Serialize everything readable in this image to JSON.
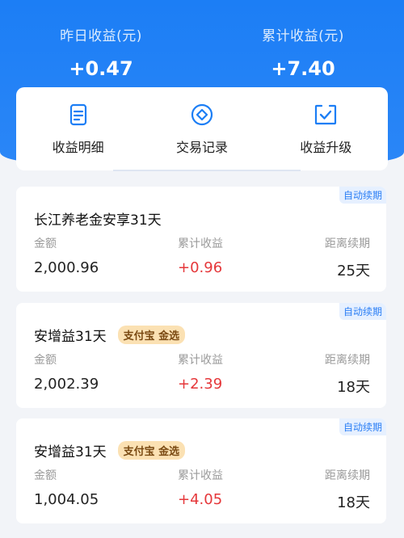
{
  "summary": {
    "yesterday_label": "昨日收益(元)",
    "yesterday_value": "+0.47",
    "total_label": "累计收益(元)",
    "total_value": "+7.40"
  },
  "menu": [
    {
      "label": "收益明细",
      "icon": "document-icon"
    },
    {
      "label": "交易记录",
      "icon": "diamond-coin-icon"
    },
    {
      "label": "收益升级",
      "icon": "check-box-icon"
    }
  ],
  "colors": {
    "brand_blue": "#1c7ef5",
    "positive_red": "#e5373a",
    "gold_tag": "#fbe1b3"
  },
  "products": [
    {
      "name": "长江养老金安享31天",
      "tag": "",
      "auto_renew": "自动续期",
      "amount_label": "金额",
      "amount": "2,000.96",
      "income_label": "累计收益",
      "income": "+0.96",
      "renew_label": "距离续期",
      "renew_days": "25天"
    },
    {
      "name": "安增益31天",
      "tag": "支付宝 金选",
      "auto_renew": "自动续期",
      "amount_label": "金额",
      "amount": "2,002.39",
      "income_label": "累计收益",
      "income": "+2.39",
      "renew_label": "距离续期",
      "renew_days": "18天"
    },
    {
      "name": "安增益31天",
      "tag": "支付宝 金选",
      "auto_renew": "自动续期",
      "amount_label": "金额",
      "amount": "1,004.05",
      "income_label": "累计收益",
      "income": "+4.05",
      "renew_label": "距离续期",
      "renew_days": "18天"
    }
  ]
}
